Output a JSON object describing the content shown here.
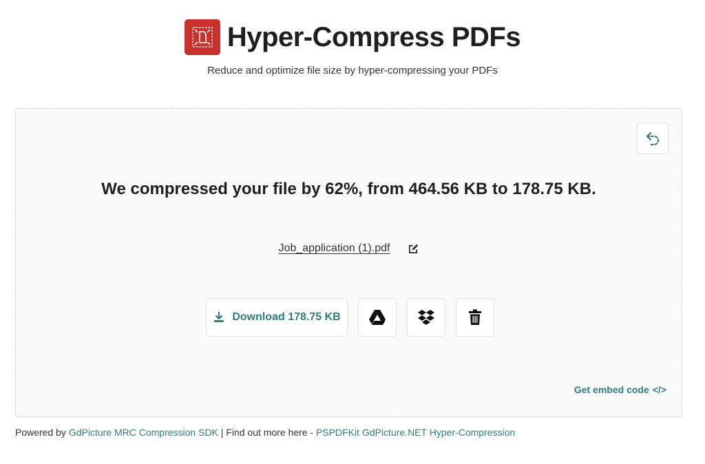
{
  "header": {
    "title": "Hyper-Compress PDFs",
    "subtitle": "Reduce and optimize file size by hyper-compressing your PDFs",
    "logo_color": "#c8312c"
  },
  "result": {
    "message": "We compressed your file by 62%, from 464.56 KB to 178.75 KB.",
    "file_name": "Job_application (1).pdf"
  },
  "actions": {
    "download_label": "Download 178.75 KB",
    "icons": [
      "download-icon",
      "google-drive-icon",
      "dropbox-icon",
      "trash-icon",
      "undo-icon",
      "edit-icon"
    ]
  },
  "embed": {
    "label": "Get embed code",
    "icon_glyph": "</>"
  },
  "footer": {
    "prefix": "Powered by ",
    "sdk_link": "GdPicture MRC Compression SDK",
    "middle": " | Find out more here - ",
    "more_link": "PSPDFKit GdPicture.NET Hyper-Compression"
  },
  "colors": {
    "accent": "#2f7d7a",
    "brand_red": "#c8312c"
  }
}
